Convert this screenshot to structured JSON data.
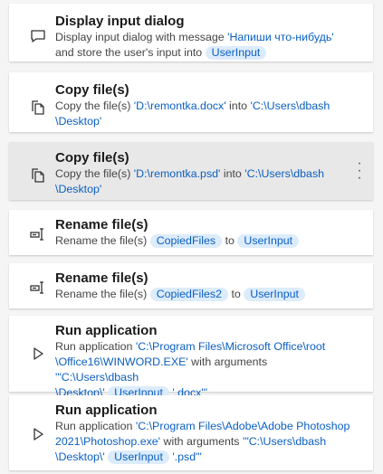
{
  "actions": [
    {
      "title": "Display input dialog",
      "icon": "message-icon",
      "d": [
        "Display input dialog with message ",
        "'Напиши что-нибудь'",
        "and store the user's input into",
        "UserInput"
      ]
    },
    {
      "title": "Copy file(s)",
      "icon": "copy-icon",
      "d": [
        "Copy the file(s) ",
        "'D:\\remontka.docx'",
        " into ",
        "'C:\\Users\\dbash",
        "\\Desktop'"
      ]
    },
    {
      "title": "Copy file(s)",
      "icon": "copy-icon",
      "d": [
        "Copy the file(s) ",
        "'D:\\remontka.psd'",
        " into ",
        "'C:\\Users\\dbash",
        "\\Desktop'"
      ]
    },
    {
      "title": "Rename file(s)",
      "icon": "rename-icon",
      "d": [
        "Rename the file(s)",
        "CopiedFiles",
        "to",
        "UserInput"
      ]
    },
    {
      "title": "Rename file(s)",
      "icon": "rename-icon",
      "d": [
        "Rename the file(s)",
        "CopiedFiles2",
        "to",
        "UserInput"
      ]
    },
    {
      "title": "Run application",
      "icon": "play-icon",
      "d": [
        "Run application ",
        "'C:\\Program Files\\Microsoft Office\\root",
        "\\Office16\\WINWORD.EXE'",
        " with arguments ",
        "'\"C:\\Users\\dbash",
        "\\Desktop\\'",
        "UserInput",
        "'.docx\"'"
      ]
    },
    {
      "title": "Run application",
      "icon": "play-icon",
      "d": [
        "Run application ",
        "'C:\\Program Files\\Adobe\\Adobe Photoshop",
        "2021\\Photoshop.exe'",
        " with arguments ",
        "'\"C:\\Users\\dbash",
        "\\Desktop\\'",
        "UserInput",
        "'.psd\"'"
      ]
    }
  ],
  "selected_index": 2
}
